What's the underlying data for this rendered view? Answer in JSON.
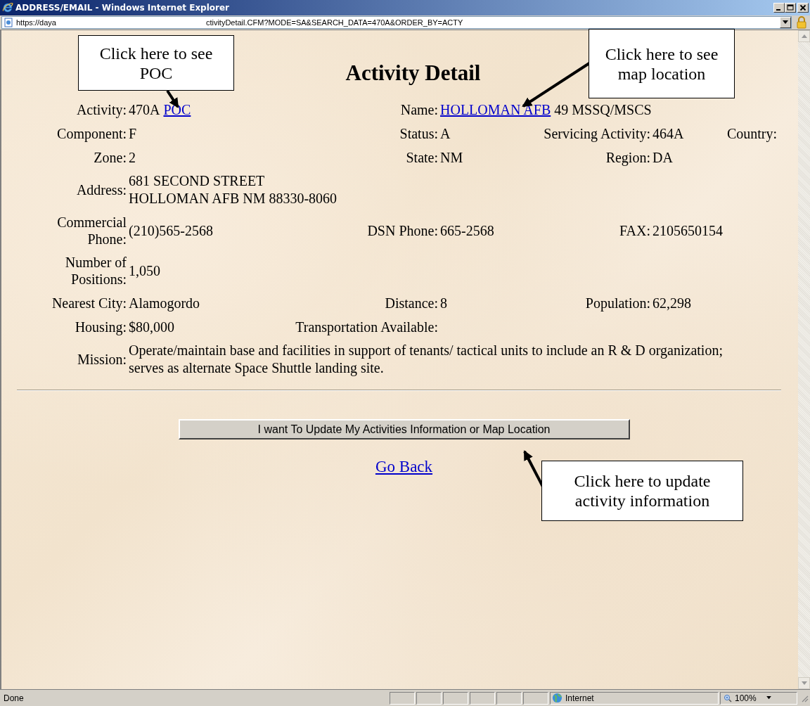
{
  "window": {
    "title": "ADDRESS/EMAIL - Windows Internet Explorer"
  },
  "address_bar": {
    "url_start": "https://daya",
    "url_end": "ctivityDetail.CFM?MODE=SA&SEARCH_DATA=470A&ORDER_BY=ACTY"
  },
  "page": {
    "heading": "Activity Detail",
    "rows": [
      {
        "kind": "fields",
        "cells": [
          {
            "label": "Activity:",
            "parts": [
              {
                "text": "470A",
                "kind": "text"
              },
              {
                "text": "POC",
                "kind": "link"
              }
            ]
          },
          {
            "label": "Name:",
            "parts": [
              {
                "text": "HOLLOMAN AFB",
                "kind": "link"
              },
              {
                "text": "49 MSSQ/MSCS",
                "kind": "text"
              }
            ]
          }
        ]
      },
      {
        "kind": "fields",
        "cells": [
          {
            "label": "Component:",
            "parts": [
              {
                "text": "F",
                "kind": "text"
              }
            ]
          },
          {
            "label": "Status:",
            "parts": [
              {
                "text": "A",
                "kind": "text"
              }
            ]
          },
          {
            "label": "Servicing Activity:",
            "parts": [
              {
                "text": "464A",
                "kind": "text"
              }
            ]
          },
          {
            "label": "Country:"
          }
        ]
      },
      {
        "kind": "fields",
        "cells": [
          {
            "label": "Zone:",
            "parts": [
              {
                "text": "2",
                "kind": "text"
              }
            ]
          },
          {
            "label": "State:",
            "parts": [
              {
                "text": "NM",
                "kind": "text"
              }
            ]
          },
          {
            "label": "Region:",
            "parts": [
              {
                "text": "DA",
                "kind": "text"
              }
            ]
          }
        ]
      },
      {
        "kind": "wide",
        "label": "Address:",
        "lines": [
          "681 SECOND STREET",
          "HOLLOMAN AFB NM 88330-8060"
        ]
      },
      {
        "kind": "tall",
        "cells": [
          {
            "label": "Commercial Phone:",
            "parts": [
              {
                "text": "(210)565-2568",
                "kind": "text"
              }
            ]
          },
          {
            "label": "DSN Phone:",
            "parts": [
              {
                "text": "665-2568",
                "kind": "text"
              }
            ]
          },
          {
            "label": "FAX:",
            "parts": [
              {
                "text": "2105650154",
                "kind": "text"
              }
            ]
          }
        ]
      },
      {
        "kind": "tall",
        "cells": [
          {
            "label": "Number of Positions:",
            "parts": [
              {
                "text": "1,050",
                "kind": "text"
              }
            ]
          }
        ]
      },
      {
        "kind": "fields",
        "cells": [
          {
            "label": "Nearest City:",
            "parts": [
              {
                "text": "Alamogordo",
                "kind": "text"
              }
            ]
          },
          {
            "label": "Distance:",
            "parts": [
              {
                "text": "8",
                "kind": "text"
              }
            ]
          },
          {
            "label": "Population:",
            "parts": [
              {
                "text": "62,298",
                "kind": "text"
              }
            ]
          }
        ]
      },
      {
        "kind": "fields",
        "cells": [
          {
            "label": "Housing:",
            "parts": [
              {
                "text": "$80,000",
                "kind": "text"
              }
            ]
          },
          {
            "label": "Transportation Available:"
          }
        ]
      },
      {
        "kind": "wide",
        "label": "Mission:",
        "lines": [
          "Operate/maintain base and facilities in support of tenants/ tactical units to include an R & D organization; serves as alternate Space Shuttle landing site."
        ]
      }
    ],
    "update_button": "I want To Update My Activities Information or Map Location",
    "back_link": "Go Back"
  },
  "callouts": [
    {
      "text": "Click here to see POC"
    },
    {
      "text": "Click here to see map location"
    },
    {
      "text": "Click here to update activity information"
    }
  ],
  "status_bar": {
    "text": "Done",
    "zone": "Internet",
    "zoom": "100%"
  }
}
